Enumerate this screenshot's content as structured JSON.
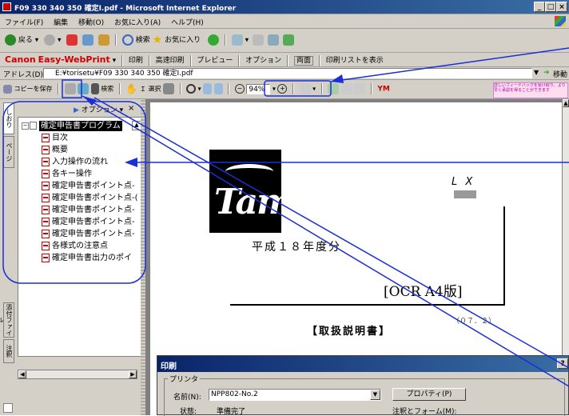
{
  "window": {
    "title": "F09 330 340 350 確定Ⅰ.pdf - Microsoft Internet Explorer",
    "controls": [
      "_",
      "□",
      "×"
    ]
  },
  "menu": {
    "items": [
      "ファイル(F)",
      "編集",
      "移動(O)",
      "お気に入り(A)",
      "ヘルプ(H)"
    ]
  },
  "toolbar": {
    "back_label": "戻る",
    "search_label": "検索",
    "favorites_label": "お気に入り"
  },
  "canon_bar": {
    "brand": "Canon",
    "product": "Easy-WebPrint",
    "print": "印刷",
    "fast_print": "高速印刷",
    "preview": "プレビュー",
    "options": "オプション",
    "both_sides": "両面",
    "print_list": "印刷リストを表示"
  },
  "address": {
    "label": "アドレス(D)",
    "value": "E:¥torisetu¥F09 330 340 350 確定Ⅰ.pdf",
    "go": "移動"
  },
  "pdf_toolbar": {
    "copy": "コピーを保存",
    "search": "検索",
    "select": "選択",
    "zoom": "94%",
    "ad_text": "詳しいフィードバックを受け取り、より早く承認を得ることができます"
  },
  "sidebar": {
    "options_label": "オプション",
    "tabs": [
      "しおり",
      "ページ",
      "添付ファイル",
      "注釈"
    ],
    "root": "確定申告書プログラム",
    "items": [
      "目次",
      "概要",
      "入力操作の流れ",
      "各キー操作",
      "確定申告書ポイント点-",
      "確定申告書ポイント点-(",
      "確定申告書ポイント点-",
      "確定申告書ポイント点-",
      "確定申告書ポイント点-",
      "各様式の注意点",
      "確定申告書出力のポイ"
    ]
  },
  "document": {
    "logo": "Tam",
    "model": "L X",
    "year": "平成１８年度分",
    "edition": "[OCR  A4版]",
    "date": "（０７．２）",
    "manual_title": "【取扱説明書】"
  },
  "print_dialog": {
    "title": "印刷",
    "group": "プリンタ",
    "name_label": "名前(N):",
    "name_value": "NPP802-No.2",
    "properties": "プロパティ(P)",
    "status_label": "状態:",
    "status_value": "準備完了",
    "form_label": "注釈とフォーム(M):"
  },
  "colors": {
    "annotation": "#1a2fd6",
    "title_bar": "#0a246a",
    "chrome": "#d4d0c8"
  }
}
